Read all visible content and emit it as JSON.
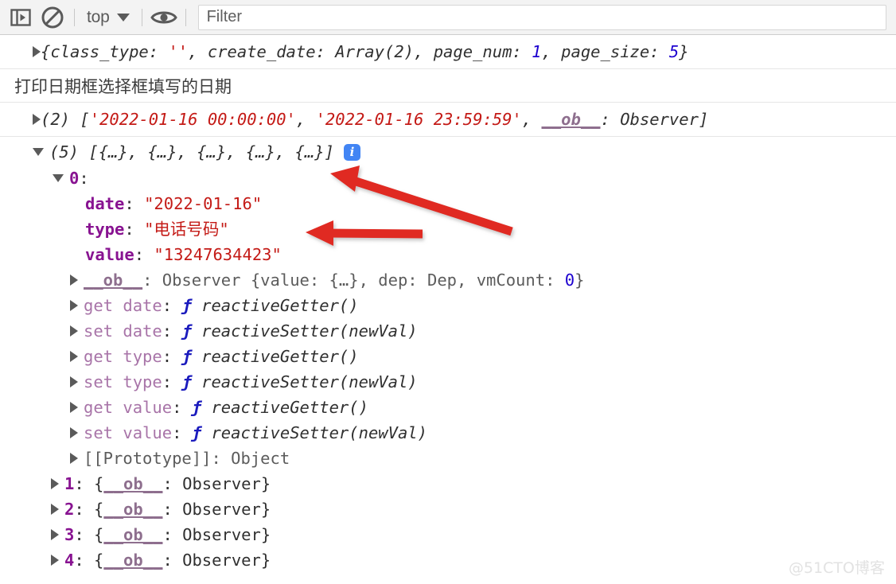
{
  "toolbar": {
    "sidebar_toggle_icon": "sidebar-panel-icon",
    "clear_console_icon": "no-entry-clear-icon",
    "context_label": "top",
    "context_caret_icon": "chevron-down-icon",
    "eye_icon": "eye-live-expression-icon",
    "filter_placeholder": "Filter"
  },
  "console": {
    "messages": [
      {
        "id": "params-object",
        "triangle": "collapsed",
        "segments": [
          {
            "t": "{class_type: ",
            "c": "plain"
          },
          {
            "t": "''",
            "c": "string"
          },
          {
            "t": ", create_date: ",
            "c": "plain"
          },
          {
            "t": "Array(2)",
            "c": "plain"
          },
          {
            "t": ", page_num: ",
            "c": "plain"
          },
          {
            "t": "1",
            "c": "number"
          },
          {
            "t": ", page_size: ",
            "c": "plain"
          },
          {
            "t": "5",
            "c": "number"
          },
          {
            "t": "}",
            "c": "plain"
          }
        ]
      },
      {
        "id": "log-label",
        "text": "打印日期框选择框填写的日期"
      },
      {
        "id": "date-range-array",
        "triangle": "collapsed",
        "segments": [
          {
            "t": "(2) [",
            "c": "plain"
          },
          {
            "t": "'2022-01-16 00:00:00'",
            "c": "string"
          },
          {
            "t": ", ",
            "c": "plain"
          },
          {
            "t": "'2022-01-16 23:59:59'",
            "c": "string"
          },
          {
            "t": ", ",
            "c": "plain"
          },
          {
            "t": "__ob__",
            "c": "obname"
          },
          {
            "t": ": Observer]",
            "c": "plain"
          }
        ]
      }
    ],
    "expanded_array": {
      "header": "(5) [{…}, {…}, {…}, {…}, {…}]",
      "info_badge": "i",
      "index_label": "0",
      "index_colon": ":",
      "properties": [
        {
          "name": "date",
          "value": "\"2022-01-16\""
        },
        {
          "name": "type",
          "value": "\"电话号码\""
        },
        {
          "name": "value",
          "value": "\"13247634423\""
        }
      ],
      "observer_row": {
        "name": "__ob__",
        "value": "Observer {value: {…}, dep: Dep, vmCount: 0}",
        "value_pre": ": Observer {value: {…}, dep: Dep, vmCount: ",
        "value_num": "0",
        "value_post": "}"
      },
      "accessors": [
        {
          "accessor": "get date",
          "fn": "reactiveGetter()"
        },
        {
          "accessor": "set date",
          "fn": "reactiveSetter(newVal)"
        },
        {
          "accessor": "get type",
          "fn": "reactiveGetter()"
        },
        {
          "accessor": "set type",
          "fn": "reactiveSetter(newVal)"
        },
        {
          "accessor": "get value",
          "fn": "reactiveGetter()"
        },
        {
          "accessor": "set value",
          "fn": "reactiveSetter(newVal)"
        }
      ],
      "prototype_row": "[[Prototype]]: Object",
      "collapsed_items": [
        {
          "index": "1",
          "preview_pre": ": {",
          "preview_name": "__ob__",
          "preview_post": ": Observer}"
        },
        {
          "index": "2",
          "preview_pre": ": {",
          "preview_name": "__ob__",
          "preview_post": ": Observer}"
        },
        {
          "index": "3",
          "preview_pre": ": {",
          "preview_name": "__ob__",
          "preview_post": ": Observer}"
        },
        {
          "index": "4",
          "preview_pre": ": {",
          "preview_name": "__ob__",
          "preview_post": ": Observer}"
        }
      ]
    }
  },
  "annotations": {
    "arrow_color": "#e02b20",
    "arrow_1_target": "array-header-row",
    "arrow_2_target": "type-property-row"
  },
  "watermark": "@51CTO博客"
}
